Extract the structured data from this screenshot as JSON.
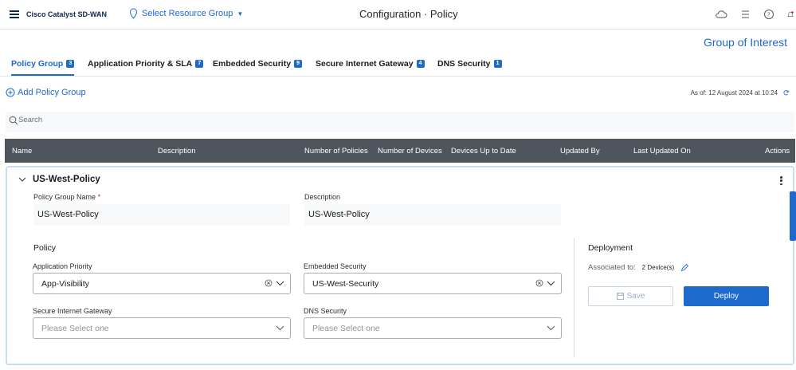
{
  "header": {
    "brand": "Cisco Catalyst SD-WAN",
    "resource_group": "Select Resource Group",
    "title_prefix": "Configuration",
    "title_separator": "·",
    "title": "Policy"
  },
  "group_of_interest": "Group of Interest",
  "tabs": [
    {
      "label": "Policy Group",
      "count": "3",
      "active": true
    },
    {
      "label": "Application Priority & SLA",
      "count": "7"
    },
    {
      "label": "Embedded Security",
      "count": "9"
    },
    {
      "label": "Secure Internet Gateway",
      "count": "4"
    },
    {
      "label": "DNS Security",
      "count": "1"
    }
  ],
  "toolbar": {
    "add_label": "Add Policy Group",
    "as_of": "As of: 12 August 2024 at 10:24"
  },
  "search": {
    "placeholder": "Search"
  },
  "table": {
    "columns": [
      "Name",
      "Description",
      "Number of Policies",
      "Number of Devices",
      "Devices Up to Date",
      "Updated By",
      "Last Updated On",
      "Actions"
    ]
  },
  "policy_group": {
    "name": "US-West-Policy",
    "name_label": "Policy Group Name",
    "required_mark": "*",
    "description_label": "Description",
    "description": "US-West-Policy",
    "policy_title": "Policy",
    "app_priority_label": "Application Priority",
    "app_priority_value": "App-Visibility",
    "embedded_security_label": "Embedded Security",
    "embedded_security_value": "US-West-Security",
    "sig_label": "Secure Internet Gateway",
    "sig_placeholder": "Please Select one",
    "dns_label": "DNS Security",
    "dns_placeholder": "Please Select one",
    "deployment_title": "Deployment",
    "associated_label": "Associated to:",
    "associated_value": "2 Device(s)",
    "save_label": "Save",
    "deploy_label": "Deploy"
  },
  "colors": {
    "accent": "#1d69cc",
    "header_bg": "#4e555d",
    "brand": "#0d274d"
  }
}
